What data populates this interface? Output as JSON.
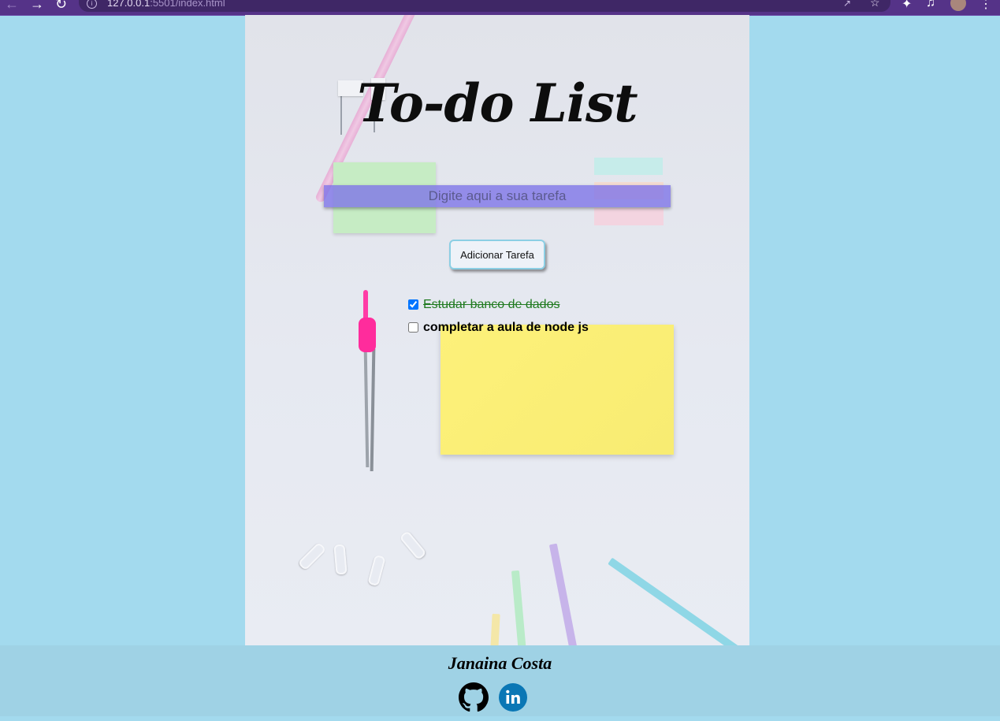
{
  "browser": {
    "url_host": "127.0.0.1",
    "url_rest": ":5501/index.html"
  },
  "app": {
    "title": "To-do List",
    "input_placeholder": "Digite aqui a sua tarefa",
    "add_button_label": "Adicionar Tarefa",
    "tasks": [
      {
        "label": "Estudar banco de dados",
        "done": true
      },
      {
        "label": "completar a aula de node js",
        "done": false
      }
    ]
  },
  "footer": {
    "author": "Janaina Costa",
    "links": [
      {
        "icon": "github-icon"
      },
      {
        "icon": "linkedin-icon"
      }
    ]
  },
  "colors": {
    "page_bg": "#a3daee",
    "browser_bar": "#553388",
    "input_bg": "#7c72e8",
    "done_text": "#1f7a1f",
    "button_border": "#8ccfe4",
    "footer_bg": "#9fd2e5",
    "linkedin_blue": "#0a77b5"
  }
}
